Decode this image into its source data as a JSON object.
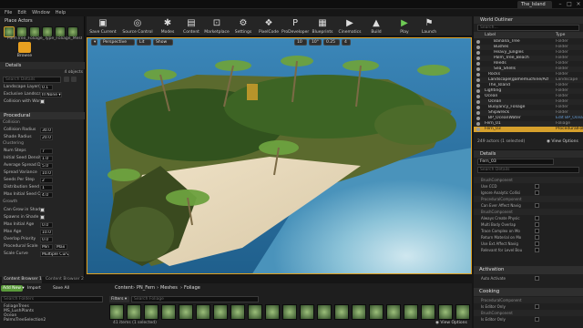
{
  "window": {
    "tab": "The_Island"
  },
  "menu": [
    "File",
    "Edit",
    "Window",
    "Help"
  ],
  "place_actors_title": "Place Actors",
  "foliage_type_label": "PalmTree_Foliage_Type_Foliage_Mesh",
  "paint_label": "Browse",
  "details_left": {
    "tab": "Details",
    "count": "4 objects",
    "search_placeholder": "Search Details",
    "top_rows": [
      {
        "label": "Landscape Layer(s) to Ignore",
        "value": "0.1"
      },
      {
        "label": "Exclusive LandscapeLayer",
        "value": "Ill None ▾"
      },
      {
        "label": "Collision with World",
        "checked": true
      }
    ],
    "procedural_title": "Procedural",
    "collision_sub": "Collision",
    "collision_rows": [
      {
        "label": "Collision Radius",
        "value": "30.0"
      },
      {
        "label": "Shade Radius",
        "value": "20.0"
      }
    ],
    "clustering_sub": "Clustering",
    "clustering_rows": [
      {
        "label": "Num Steps",
        "value": "7"
      },
      {
        "label": "Initial Seed Density",
        "value": "1.0"
      },
      {
        "label": "Average Spread Distan",
        "value": "5.0"
      },
      {
        "label": "Spread Variance",
        "value": "10.0"
      },
      {
        "label": "Seeds Per Step",
        "value": "2"
      },
      {
        "label": "Distribution Seed",
        "value": "1"
      },
      {
        "label": "Max Initial Seed Offset",
        "value": "4.0"
      }
    ],
    "growth_sub": "Growth",
    "growth_rows": [
      {
        "label": "Can Grow in Shade",
        "checked": true
      },
      {
        "label": "Spawns in Shade",
        "checked": true
      },
      {
        "label": "Max Initial Age",
        "value": "0.0"
      },
      {
        "label": "Max Age",
        "value": "10.0"
      },
      {
        "label": "Overlap Priority",
        "value": "0.0"
      },
      {
        "label": "Procedural Scale",
        "value": "Min"
      },
      {
        "label": "Scale Curve",
        "value": "Multiple Curves"
      }
    ],
    "procedural_scale_max": "Max"
  },
  "toolbar": [
    {
      "label": "Save Current",
      "icon": "save-icon",
      "glyph": "▣"
    },
    {
      "label": "Source Control",
      "icon": "source-control-icon",
      "glyph": "◎"
    },
    {
      "label": "Modes",
      "icon": "modes-icon",
      "glyph": "✱"
    },
    {
      "label": "Content",
      "icon": "content-icon",
      "glyph": "▤"
    },
    {
      "label": "Marketplace",
      "icon": "marketplace-icon",
      "glyph": "⊡"
    },
    {
      "label": "Settings",
      "icon": "settings-icon",
      "glyph": "⚙"
    },
    {
      "label": "PixelCode",
      "icon": "pixelcode-icon",
      "glyph": "❖"
    },
    {
      "label": "ProDeveloper",
      "icon": "prodeveloper-icon",
      "glyph": "P"
    },
    {
      "label": "Blueprints",
      "icon": "blueprints-icon",
      "glyph": "▦"
    },
    {
      "label": "Cinematics",
      "icon": "cinematics-icon",
      "glyph": "▶"
    },
    {
      "label": "Build",
      "icon": "build-icon",
      "glyph": "▲"
    },
    {
      "label": "Play",
      "icon": "play-icon",
      "glyph": "▶"
    },
    {
      "label": "Launch",
      "icon": "launch-icon",
      "glyph": "⚑"
    }
  ],
  "viewport": {
    "perspective": "Perspective",
    "lit": "Lit",
    "show": "Show",
    "snap": "10",
    "angle": "10°",
    "scale": "0.25",
    "speed": "4"
  },
  "outliner": {
    "tab": "World Outliner",
    "search_placeholder": "Search...",
    "col_label": "Label",
    "col_type": "Type",
    "rows": [
      {
        "label": "Banana_Tree",
        "type": "Folder"
      },
      {
        "label": "Bushes",
        "type": "Folder"
      },
      {
        "label": "Heavy_Jungles",
        "type": "Folder"
      },
      {
        "label": "Palm_Tree_Beach",
        "type": "Folder"
      },
      {
        "label": "Reeds",
        "type": "Folder"
      },
      {
        "label": "Sea_Shells",
        "type": "Folder"
      },
      {
        "label": "Rocks",
        "type": "Folder"
      },
      {
        "label": "Landscape(gamemuchine/Actor)",
        "type": "Landscape"
      },
      {
        "label": "The_Island",
        "type": "Folder"
      },
      {
        "label": "Lighting",
        "type": "Folder"
      },
      {
        "label": "Ocean",
        "type": "Folder"
      },
      {
        "label": "Ocean",
        "type": "Folder"
      },
      {
        "label": "Buoyancy_Foliage",
        "type": "Folder"
      },
      {
        "label": "Shipwreck",
        "type": "Folder"
      },
      {
        "label": "BP_OceanWater",
        "type": "Edit BP_Ocean"
      },
      {
        "label": "Fern_01",
        "type": "Foliage"
      },
      {
        "label": "Fern_03",
        "type": "ProceduralFoliage"
      }
    ],
    "selected_index": 16,
    "actors": "249 actors (1 selected)",
    "view_options": "◉ View Options"
  },
  "details_right": {
    "tab": "Details",
    "name": "Fern_03",
    "search_placeholder": "Search Details",
    "rows": [
      {
        "label": "BrushComponent",
        "cat": true
      },
      {
        "label": "Use CCD"
      },
      {
        "label": "Ignore Analytic Collisi"
      },
      {
        "label": "ProceduralComponent",
        "cat": true
      },
      {
        "label": "Can Ever Affect Navig"
      },
      {
        "label": "BrushComponent",
        "cat": true
      },
      {
        "label": "Always Create Physic"
      },
      {
        "label": "Multi Body Overlap"
      },
      {
        "label": "Trace Complex on Mo"
      },
      {
        "label": "Return Material on Mo"
      },
      {
        "label": "Use Ext Affect Navig"
      },
      {
        "label": "Relevant for Level Bou"
      }
    ],
    "activation_title": "Activation",
    "activation_row": "Auto Activate",
    "cooking_title": "Cooking",
    "cooking_rows": [
      {
        "label": "ProceduralComponent",
        "cat": true
      },
      {
        "label": "Is Editor Only"
      },
      {
        "label": "BrushComponent",
        "cat": true
      },
      {
        "label": "Is Editor Only"
      }
    ]
  },
  "content_browser": {
    "tabs": [
      "Content Browser 1",
      "Content Browser 2"
    ],
    "add_new": "Add New ▾",
    "import": "Import",
    "save_all": "Save All",
    "breadcrumb": [
      "Content",
      "PN_Fern",
      "Meshes",
      "Foliage"
    ],
    "search_folders": "Search Folders",
    "filters": "Filters ▾",
    "search_placeholder": "Search Foliage",
    "tree": [
      "FoliageTrees",
      "MS_LushPlants",
      "Ocean",
      "PalmsTreeSelection2"
    ],
    "items": "41 items (1 selected)",
    "view_options": "◉ View Options",
    "asset_count": 21
  }
}
